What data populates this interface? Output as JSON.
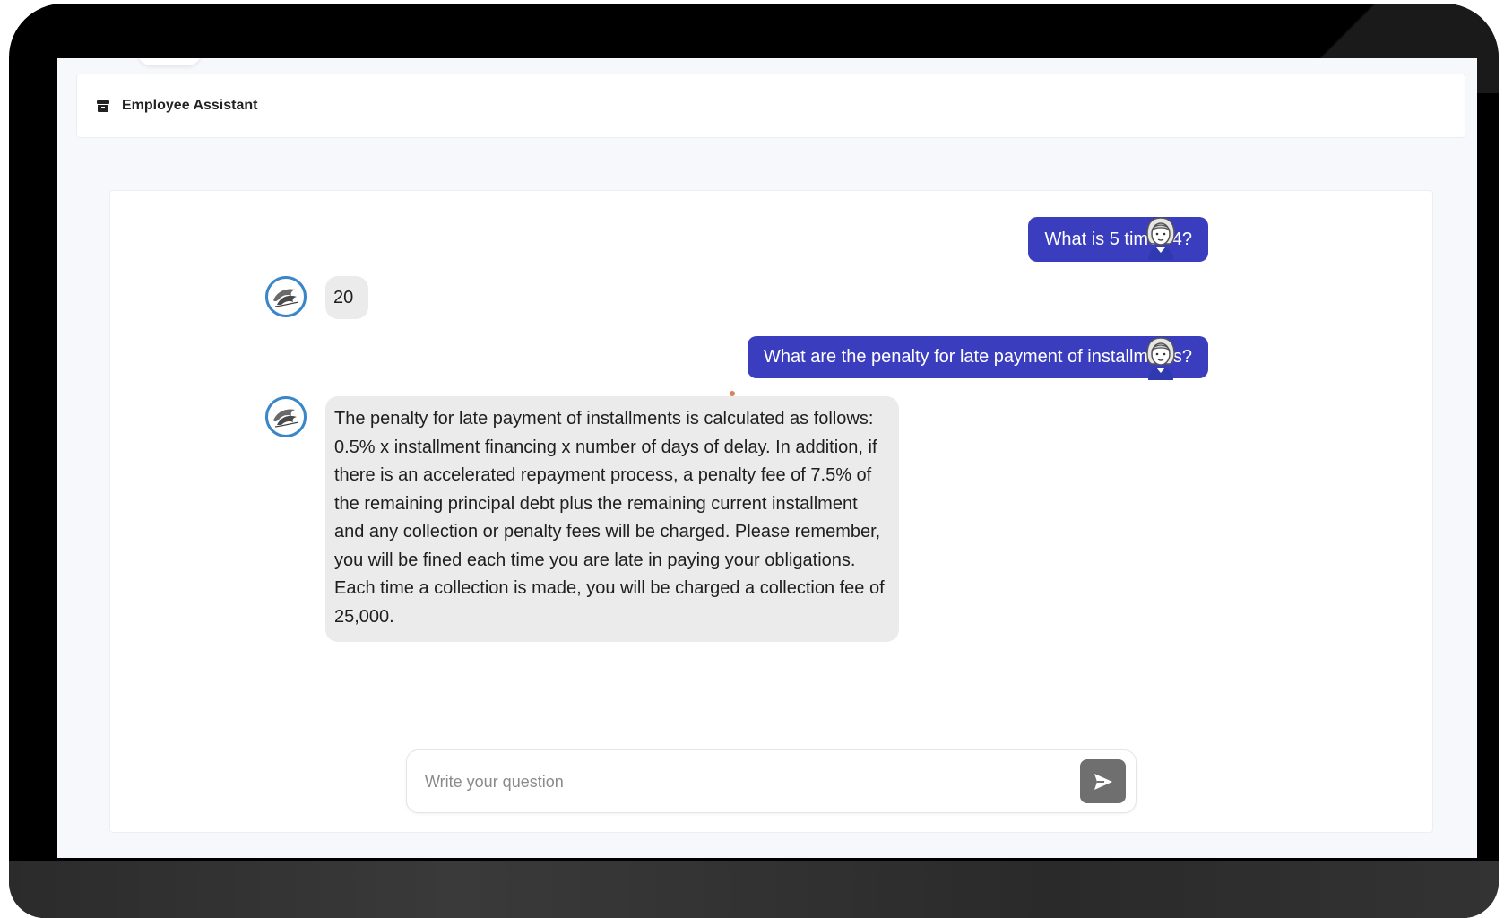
{
  "app": {
    "title": "Employee Assistant",
    "icon": "archive-box-icon"
  },
  "conversation": [
    {
      "role": "user",
      "text": "What is 5 times 4?"
    },
    {
      "role": "assistant",
      "text": "20"
    },
    {
      "role": "user",
      "text": "What are the penalty for late payment of installments?"
    },
    {
      "role": "assistant",
      "text": "The penalty for late payment of installments is calculated as follows: 0.5% x installment financing x number of days of delay. In addition, if there is an accelerated repayment process, a penalty fee of 7.5% of the remaining principal debt plus the remaining current installment and any collection or penalty fees will be charged. Please remember, you will be fined each time you are late in paying your obligations. Each time a collection is made, you will be charged a collection fee of 25,000."
    }
  ],
  "composer": {
    "placeholder": "Write your question",
    "value": "",
    "send_icon": "send-icon"
  },
  "colors": {
    "user_bubble": "#3b3dbf",
    "assistant_bubble": "#ebebeb",
    "bot_avatar_ring": "#3a86c8",
    "send_button": "#6f6f6f"
  }
}
